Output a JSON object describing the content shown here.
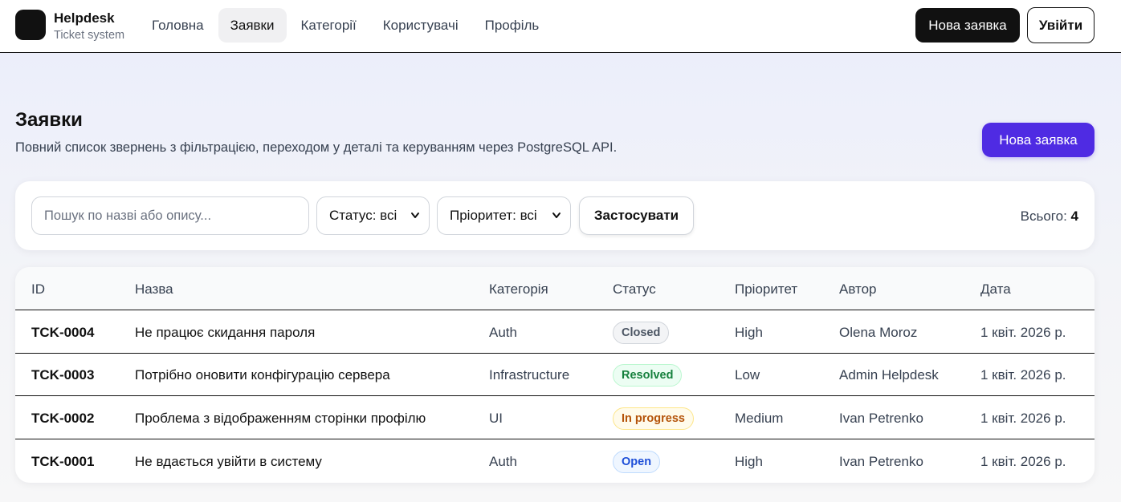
{
  "brand": {
    "title": "Helpdesk",
    "subtitle": "Ticket system"
  },
  "nav": {
    "items": [
      "Головна",
      "Заявки",
      "Категорії",
      "Користувачі",
      "Профіль"
    ],
    "active_index": 1
  },
  "header_actions": {
    "new_ticket": "Нова заявка",
    "logout": "Увійти"
  },
  "page": {
    "title": "Заявки",
    "subtitle": "Повний список звернень з фільтрацією, переходом у деталі та керуванням через PostgreSQL API.",
    "primary_action": "Нова заявка"
  },
  "filters": {
    "search_placeholder": "Пошук по назві або опису...",
    "search_value": "",
    "status_selected": "Статус: всі",
    "priority_selected": "Пріоритет: всі",
    "apply": "Застосувати",
    "total_label": "Всього:",
    "total_value": "4"
  },
  "table": {
    "columns": [
      "ID",
      "Назва",
      "Категорія",
      "Статус",
      "Пріоритет",
      "Автор",
      "Дата"
    ],
    "rows": [
      {
        "id": "TCK-0004",
        "title": "Не працює скидання пароля",
        "category": "Auth",
        "status": "Closed",
        "priority": "High",
        "author": "Olena Moroz",
        "date": "1 квіт. 2026 р."
      },
      {
        "id": "TCK-0003",
        "title": "Потрібно оновити конфігурацію сервера",
        "category": "Infrastructure",
        "status": "Resolved",
        "priority": "Low",
        "author": "Admin Helpdesk",
        "date": "1 квіт. 2026 р."
      },
      {
        "id": "TCK-0002",
        "title": "Проблема з відображенням сторінки профілю",
        "category": "UI",
        "status": "In progress",
        "priority": "Medium",
        "author": "Ivan Petrenko",
        "date": "1 квіт. 2026 р."
      },
      {
        "id": "TCK-0001",
        "title": "Не вдається увійти в систему",
        "category": "Auth",
        "status": "Open",
        "priority": "High",
        "author": "Ivan Petrenko",
        "date": "1 квіт. 2026 р."
      }
    ]
  },
  "status_colors": {
    "Closed": {
      "bg": "#f3f4f6",
      "fg": "#4b5563",
      "border": "#d1d5db"
    },
    "Resolved": {
      "bg": "#ecfdf3",
      "fg": "#15803d",
      "border": "#bbf7d0"
    },
    "In progress": {
      "bg": "#fffbeb",
      "fg": "#b45309",
      "border": "#fde68a"
    },
    "Open": {
      "bg": "#eff6ff",
      "fg": "#1d4ed8",
      "border": "#bfdbfe"
    }
  },
  "icons": {
    "logo": "logo-square-icon",
    "select_chevron": "chevron-down-icon"
  },
  "colors": {
    "accent": "#4f2be3",
    "dark": "#111111"
  }
}
